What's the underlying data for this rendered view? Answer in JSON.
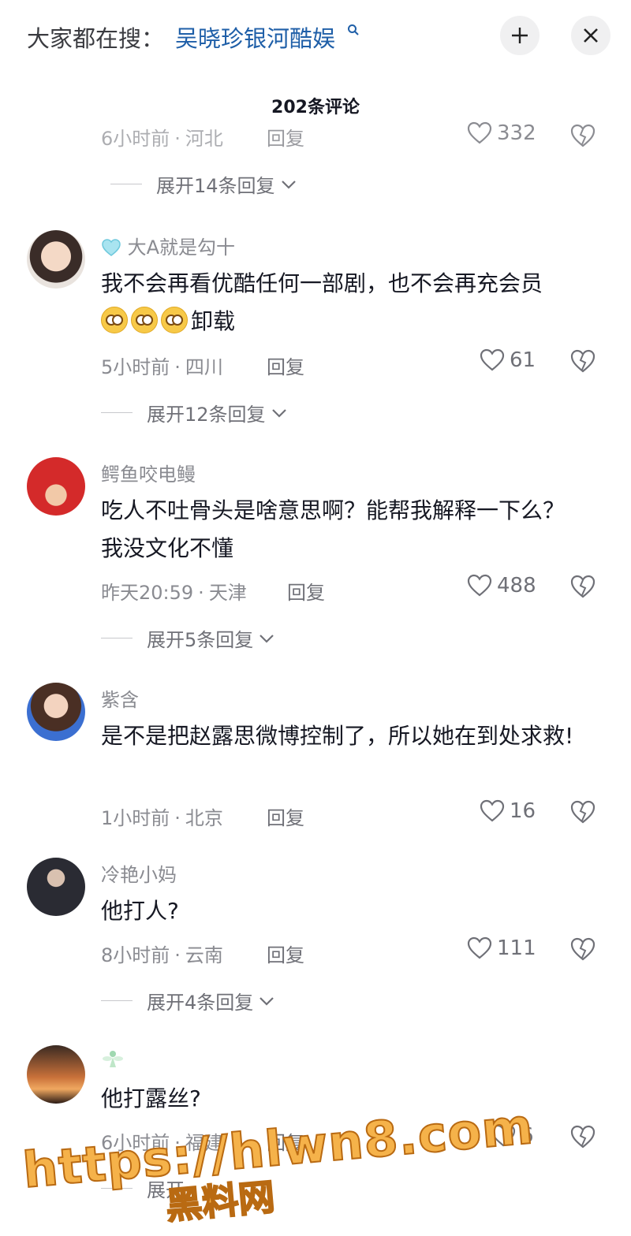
{
  "header": {
    "search_prefix": "大家都在搜：",
    "search_term": "吴晓珍银河酷娱",
    "collapse_icon": "collapse-icon",
    "close_icon": "close-icon"
  },
  "comment_count_title": "202条评论",
  "comments": [
    {
      "time": "6小时前",
      "location": "河北",
      "reply_label": "回复",
      "likes": "332",
      "expand_label": "展开14条回复"
    },
    {
      "username": "大A就是勾十",
      "text": "我不会再看优酷任何一部剧，也不会再充会员",
      "text_suffix": "卸载",
      "time": "5小时前",
      "location": "四川",
      "reply_label": "回复",
      "likes": "61",
      "expand_label": "展开12条回复"
    },
    {
      "username": "鳄鱼咬电鳗",
      "text": "吃人不吐骨头是啥意思啊？能帮我解释一下么？我没文化不懂",
      "time": "昨天20:59",
      "location": "天津",
      "reply_label": "回复",
      "likes": "488",
      "expand_label": "展开5条回复"
    },
    {
      "username": "紫含",
      "text": "是不是把赵露思微博控制了，所以她在到处求救!",
      "time": "1小时前",
      "location": "北京",
      "reply_label": "回复",
      "likes": "16"
    },
    {
      "username": "冷艳小妈",
      "text": "他打人?",
      "time": "8小时前",
      "location": "云南",
      "reply_label": "回复",
      "likes": "111",
      "expand_label": "展开4条回复"
    },
    {
      "username": "",
      "text": "他打露丝?",
      "time": "6小时前",
      "location": "福建",
      "reply_label": "回复",
      "likes": "6",
      "expand_label": "展开"
    }
  ],
  "watermark": {
    "line1": "https://hlwn8.com",
    "line2": "黑料网"
  },
  "colors": {
    "search_term": "#1f5fa8",
    "meta_gray": "#8a8b91",
    "watermark": "#f5b24a"
  }
}
